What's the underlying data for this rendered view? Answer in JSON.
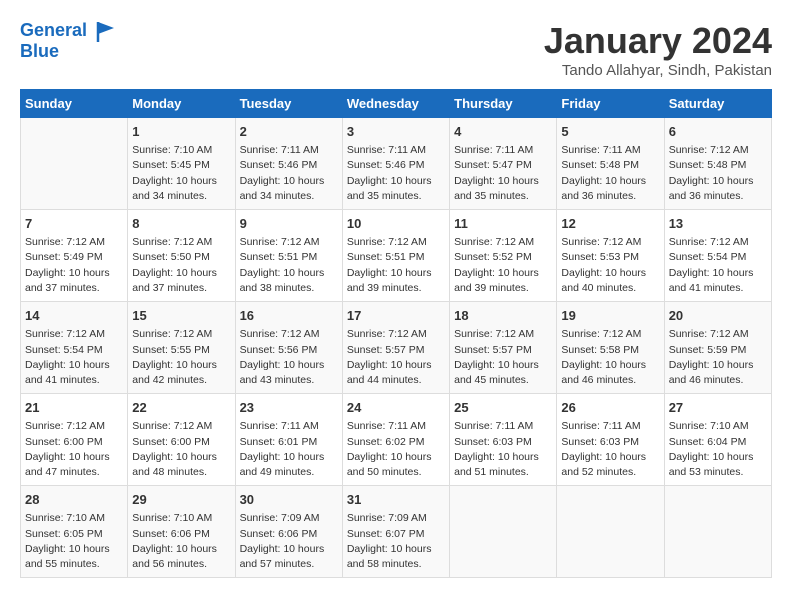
{
  "header": {
    "logo_line1": "General",
    "logo_line2": "Blue",
    "month": "January 2024",
    "location": "Tando Allahyar, Sindh, Pakistan"
  },
  "weekdays": [
    "Sunday",
    "Monday",
    "Tuesday",
    "Wednesday",
    "Thursday",
    "Friday",
    "Saturday"
  ],
  "weeks": [
    [
      {
        "day": "",
        "info": ""
      },
      {
        "day": "1",
        "info": "Sunrise: 7:10 AM\nSunset: 5:45 PM\nDaylight: 10 hours\nand 34 minutes."
      },
      {
        "day": "2",
        "info": "Sunrise: 7:11 AM\nSunset: 5:46 PM\nDaylight: 10 hours\nand 34 minutes."
      },
      {
        "day": "3",
        "info": "Sunrise: 7:11 AM\nSunset: 5:46 PM\nDaylight: 10 hours\nand 35 minutes."
      },
      {
        "day": "4",
        "info": "Sunrise: 7:11 AM\nSunset: 5:47 PM\nDaylight: 10 hours\nand 35 minutes."
      },
      {
        "day": "5",
        "info": "Sunrise: 7:11 AM\nSunset: 5:48 PM\nDaylight: 10 hours\nand 36 minutes."
      },
      {
        "day": "6",
        "info": "Sunrise: 7:12 AM\nSunset: 5:48 PM\nDaylight: 10 hours\nand 36 minutes."
      }
    ],
    [
      {
        "day": "7",
        "info": "Sunrise: 7:12 AM\nSunset: 5:49 PM\nDaylight: 10 hours\nand 37 minutes."
      },
      {
        "day": "8",
        "info": "Sunrise: 7:12 AM\nSunset: 5:50 PM\nDaylight: 10 hours\nand 37 minutes."
      },
      {
        "day": "9",
        "info": "Sunrise: 7:12 AM\nSunset: 5:51 PM\nDaylight: 10 hours\nand 38 minutes."
      },
      {
        "day": "10",
        "info": "Sunrise: 7:12 AM\nSunset: 5:51 PM\nDaylight: 10 hours\nand 39 minutes."
      },
      {
        "day": "11",
        "info": "Sunrise: 7:12 AM\nSunset: 5:52 PM\nDaylight: 10 hours\nand 39 minutes."
      },
      {
        "day": "12",
        "info": "Sunrise: 7:12 AM\nSunset: 5:53 PM\nDaylight: 10 hours\nand 40 minutes."
      },
      {
        "day": "13",
        "info": "Sunrise: 7:12 AM\nSunset: 5:54 PM\nDaylight: 10 hours\nand 41 minutes."
      }
    ],
    [
      {
        "day": "14",
        "info": "Sunrise: 7:12 AM\nSunset: 5:54 PM\nDaylight: 10 hours\nand 41 minutes."
      },
      {
        "day": "15",
        "info": "Sunrise: 7:12 AM\nSunset: 5:55 PM\nDaylight: 10 hours\nand 42 minutes."
      },
      {
        "day": "16",
        "info": "Sunrise: 7:12 AM\nSunset: 5:56 PM\nDaylight: 10 hours\nand 43 minutes."
      },
      {
        "day": "17",
        "info": "Sunrise: 7:12 AM\nSunset: 5:57 PM\nDaylight: 10 hours\nand 44 minutes."
      },
      {
        "day": "18",
        "info": "Sunrise: 7:12 AM\nSunset: 5:57 PM\nDaylight: 10 hours\nand 45 minutes."
      },
      {
        "day": "19",
        "info": "Sunrise: 7:12 AM\nSunset: 5:58 PM\nDaylight: 10 hours\nand 46 minutes."
      },
      {
        "day": "20",
        "info": "Sunrise: 7:12 AM\nSunset: 5:59 PM\nDaylight: 10 hours\nand 46 minutes."
      }
    ],
    [
      {
        "day": "21",
        "info": "Sunrise: 7:12 AM\nSunset: 6:00 PM\nDaylight: 10 hours\nand 47 minutes."
      },
      {
        "day": "22",
        "info": "Sunrise: 7:12 AM\nSunset: 6:00 PM\nDaylight: 10 hours\nand 48 minutes."
      },
      {
        "day": "23",
        "info": "Sunrise: 7:11 AM\nSunset: 6:01 PM\nDaylight: 10 hours\nand 49 minutes."
      },
      {
        "day": "24",
        "info": "Sunrise: 7:11 AM\nSunset: 6:02 PM\nDaylight: 10 hours\nand 50 minutes."
      },
      {
        "day": "25",
        "info": "Sunrise: 7:11 AM\nSunset: 6:03 PM\nDaylight: 10 hours\nand 51 minutes."
      },
      {
        "day": "26",
        "info": "Sunrise: 7:11 AM\nSunset: 6:03 PM\nDaylight: 10 hours\nand 52 minutes."
      },
      {
        "day": "27",
        "info": "Sunrise: 7:10 AM\nSunset: 6:04 PM\nDaylight: 10 hours\nand 53 minutes."
      }
    ],
    [
      {
        "day": "28",
        "info": "Sunrise: 7:10 AM\nSunset: 6:05 PM\nDaylight: 10 hours\nand 55 minutes."
      },
      {
        "day": "29",
        "info": "Sunrise: 7:10 AM\nSunset: 6:06 PM\nDaylight: 10 hours\nand 56 minutes."
      },
      {
        "day": "30",
        "info": "Sunrise: 7:09 AM\nSunset: 6:06 PM\nDaylight: 10 hours\nand 57 minutes."
      },
      {
        "day": "31",
        "info": "Sunrise: 7:09 AM\nSunset: 6:07 PM\nDaylight: 10 hours\nand 58 minutes."
      },
      {
        "day": "",
        "info": ""
      },
      {
        "day": "",
        "info": ""
      },
      {
        "day": "",
        "info": ""
      }
    ]
  ]
}
